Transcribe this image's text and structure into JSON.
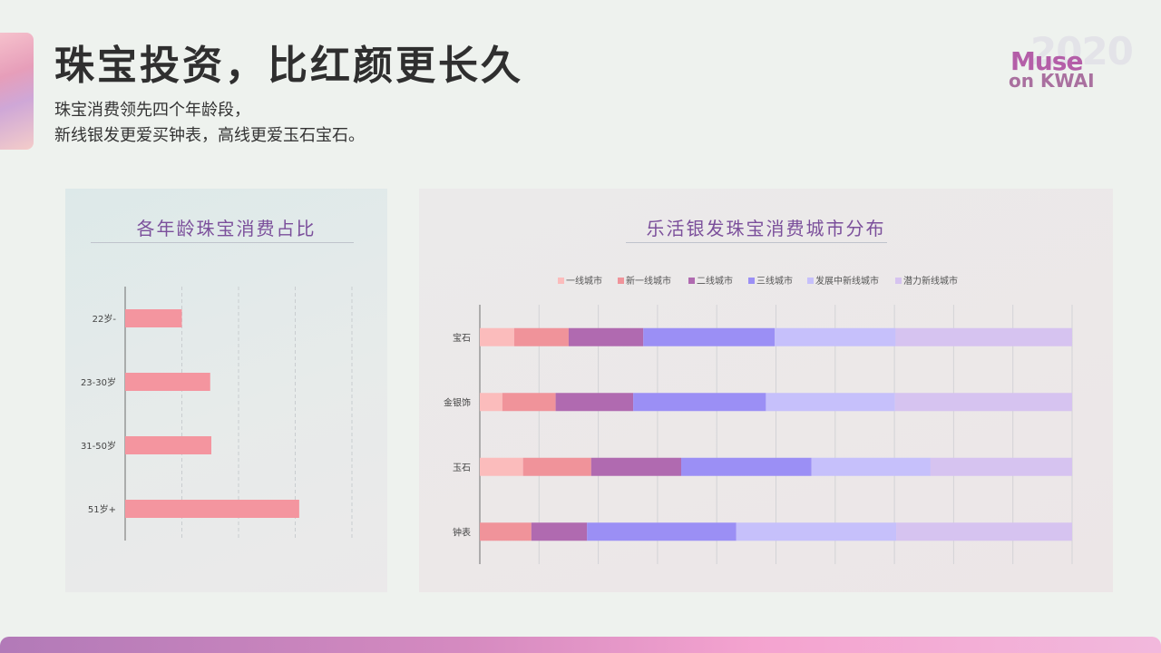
{
  "header": {
    "title": "珠宝投资，比红颜更长久",
    "subtitle_lines": [
      "珠宝消费领先四个年龄段，",
      "新线银发更爱买钟表，高线更爱玉石宝石。"
    ]
  },
  "logo": {
    "year": "2020",
    "line1": "Muse",
    "line2": "on KWAI"
  },
  "left_panel": {
    "title": "各年龄珠宝消费占比"
  },
  "right_panel": {
    "title": "乐活银发珠宝消费城市分布"
  },
  "colors": {
    "age_bar": "#f4959f",
    "series": [
      "#fbbcbc",
      "#f0939a",
      "#b06ab0",
      "#9b8ff5",
      "#c6c0fb",
      "#d6c3f0"
    ]
  },
  "chart_data": [
    {
      "type": "bar",
      "orientation": "horizontal",
      "title": "各年龄珠宝消费占比",
      "categories": [
        "22岁-",
        "23-30岁",
        "31-50岁",
        "51岁+"
      ],
      "values": [
        10,
        15,
        15.2,
        30.7
      ],
      "xlim": [
        0,
        40
      ],
      "grid": true
    },
    {
      "type": "bar",
      "orientation": "horizontal",
      "stacked": true,
      "title": "乐活银发珠宝消费城市分布",
      "categories": [
        "宝石",
        "金银饰",
        "玉石",
        "钟表"
      ],
      "legend_position": "top",
      "series": [
        {
          "name": "一线城市",
          "values": [
            5.8,
            3.8,
            7.3,
            0
          ]
        },
        {
          "name": "新一线城市",
          "values": [
            9.2,
            9.0,
            11.5,
            8.7
          ]
        },
        {
          "name": "二线城市",
          "values": [
            12.6,
            13.1,
            15.2,
            9.4
          ]
        },
        {
          "name": "三线城市",
          "values": [
            22.2,
            22.4,
            22.0,
            25.2
          ]
        },
        {
          "name": "发展中新线城市",
          "values": [
            20.4,
            21.8,
            20.1,
            27.0
          ]
        },
        {
          "name": "潜力新线城市",
          "values": [
            29.8,
            29.9,
            23.9,
            29.7
          ]
        }
      ],
      "xlim": [
        0,
        100
      ],
      "grid": true
    }
  ]
}
